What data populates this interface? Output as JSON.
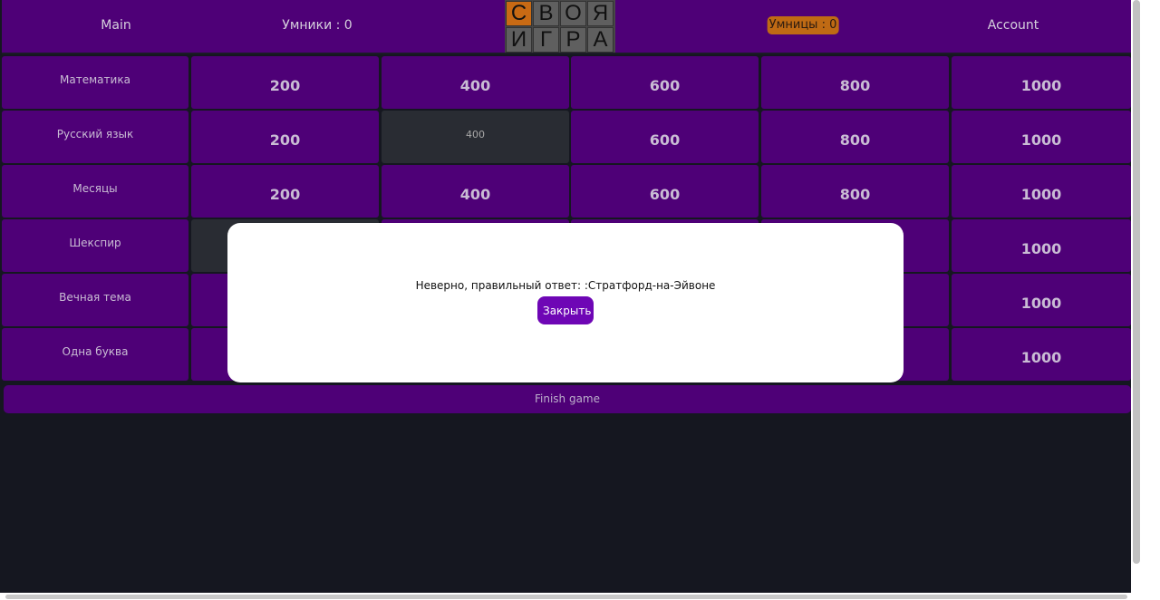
{
  "header": {
    "main_label": "Main",
    "score_boys": "Умники : 0",
    "score_girls": "Умницы : 0",
    "account_label": "Account",
    "logo_letters": [
      "С",
      "В",
      "О",
      "Я",
      "И",
      "Г",
      "Р",
      "А"
    ]
  },
  "board": {
    "categories": [
      "Математика",
      "Русский язык",
      "Месяцы",
      "Шекспир",
      "Вечная тема",
      "Одна буква"
    ],
    "prices": [
      "200",
      "400",
      "600",
      "800",
      "1000"
    ],
    "used_cell_label": "400"
  },
  "finish_label": "Finish game",
  "modal": {
    "message": "Неверно, правильный ответ: :Стратфорд-на-Эйвоне",
    "close_label": "Закрыть"
  },
  "colors": {
    "cell": "#4e0077",
    "used_cell": "#292c33",
    "background": "#151720",
    "accent": "#c86a14",
    "button": "#6e06b5"
  }
}
